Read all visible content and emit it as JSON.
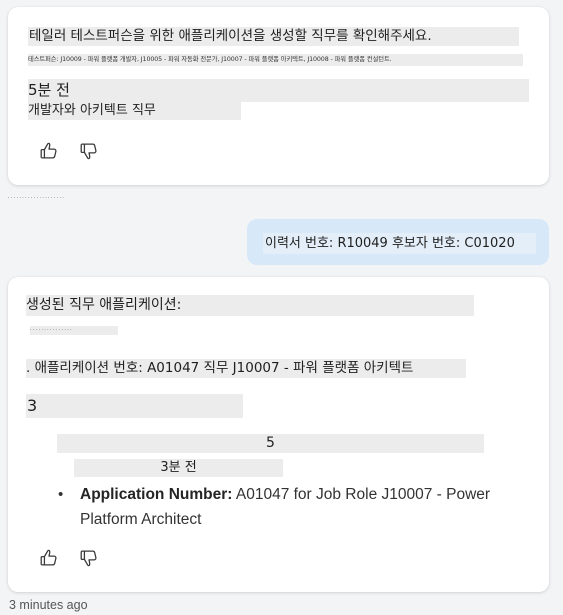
{
  "card1": {
    "title": "테일러 테스트퍼슨을 위한 애플리케이션을 생성할 직무를 확인해주세요.",
    "subtitle": "테스트퍼슨: J10009 - 파워 플랫폼 개발자, J10005 - 파워 자동화 전문가, J10007 - 파워 플랫폼 아키텍트, J10008 - 파워 플랫폼 컨설턴트.",
    "time": "5분 전",
    "selected_jobs": "개발자와 아키텍트 직무",
    "thumbs_up_icon": "thumbs-up-icon",
    "thumbs_down_icon": "thumbs-down-icon"
  },
  "tiny_caption": "· · · · · · · ·  · · ·  · · · ·  · · ·  · ·",
  "user_message": {
    "text": "이력서 번호: R10049 후보자 번호: C01020",
    "bubble_color": "#d7e9f9"
  },
  "card2": {
    "title": "생성된 직무 애플리케이션:",
    "tiny": "· · · · · · · ·  · · ·  · · · ·",
    "app_line": ". 애플리케이션 번호: A01047 직무 J10007 - 파워 플랫폼 아키텍트",
    "three": "3",
    "five": "5",
    "ago": "3분 전",
    "bullet_label": "Application Number:",
    "bullet_value": " A01047 for Job Role J10007 - Power Platform Architect",
    "thumbs_up_icon": "thumbs-up-icon",
    "thumbs_down_icon": "thumbs-down-icon"
  },
  "footer": {
    "time": "3 minutes ago"
  }
}
